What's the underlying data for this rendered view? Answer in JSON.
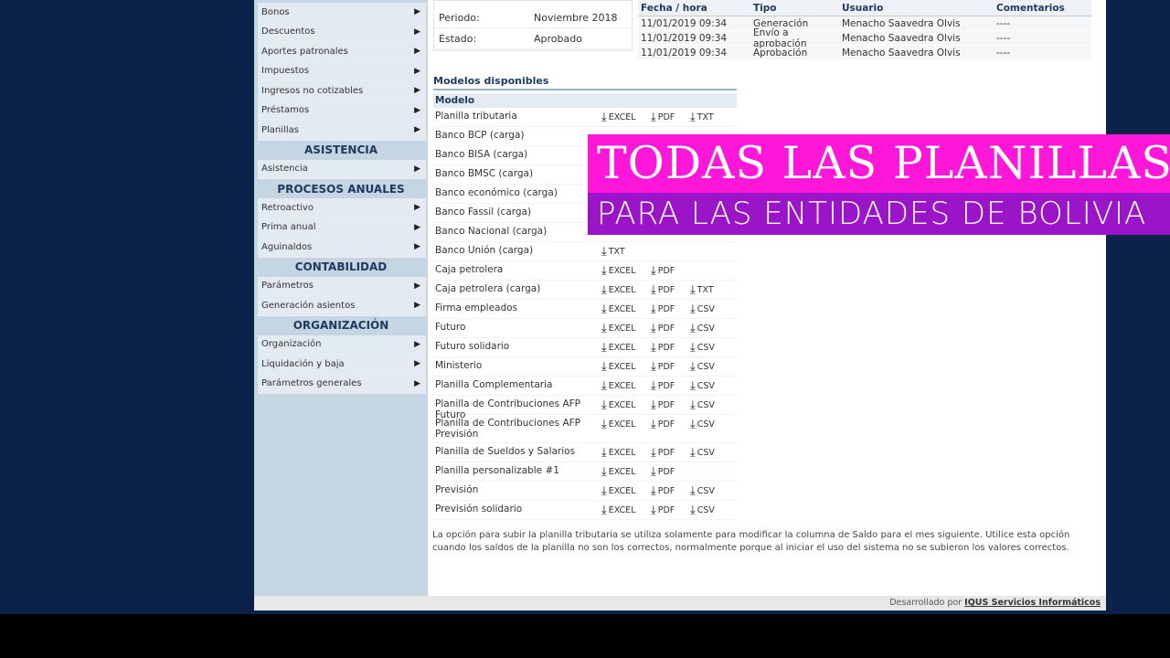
{
  "sidebar": {
    "groups": [
      {
        "heading": "",
        "items": [
          "Bonos",
          "Descuentos",
          "Aportes patronales",
          "Impuestos",
          "Ingresos no cotizables",
          "Préstamos",
          "Planillas"
        ]
      },
      {
        "heading": "ASISTENCIA",
        "items": [
          "Asistencia"
        ]
      },
      {
        "heading": "PROCESOS ANUALES",
        "items": [
          "Retroactivo",
          "Prima anual",
          "Aguinaldos"
        ]
      },
      {
        "heading": "CONTABILIDAD",
        "items": [
          "Parámetros",
          "Generación asientos"
        ]
      },
      {
        "heading": "ORGANIZACIÓN",
        "items": [
          "Organización",
          "Liquidación y baja",
          "Parámetros generales"
        ]
      }
    ]
  },
  "info": {
    "period_label": "Periodo:",
    "period_value": "Noviembre 2018",
    "state_label": "Estado:",
    "state_value": "Aprobado"
  },
  "history": {
    "headers": [
      "Fecha / hora",
      "Tipo",
      "Usuario",
      "Comentarios"
    ],
    "rows": [
      [
        "11/01/2019 09:34",
        "Generación",
        "Menacho Saavedra Olvis",
        "----"
      ],
      [
        "11/01/2019 09:34",
        "Envío a aprobación",
        "Menacho Saavedra Olvis",
        "----"
      ],
      [
        "11/01/2019 09:34",
        "Aprobación",
        "Menacho Saavedra Olvis",
        "----"
      ]
    ]
  },
  "models": {
    "title": "Modelos disponibles",
    "column_header": "Modelo",
    "rows": [
      {
        "name": "Planilla tributaria",
        "dl": [
          "EXCEL",
          "PDF",
          "TXT"
        ]
      },
      {
        "name": "Banco BCP (carga)",
        "dl": [
          "",
          "",
          ""
        ]
      },
      {
        "name": "Banco BISA (carga)",
        "dl": [
          "",
          "",
          ""
        ]
      },
      {
        "name": "Banco BMSC (carga)",
        "dl": [
          "",
          "",
          ""
        ]
      },
      {
        "name": "Banco económico (carga)",
        "dl": [
          "",
          "",
          ""
        ]
      },
      {
        "name": "Banco Fassil (carga)",
        "dl": [
          "",
          "",
          ""
        ]
      },
      {
        "name": "Banco Nacional (carga)",
        "dl": [
          "",
          "",
          ""
        ]
      },
      {
        "name": "Banco Unión (carga)",
        "dl": [
          "TXT",
          "",
          ""
        ]
      },
      {
        "name": "Caja petrolera",
        "dl": [
          "EXCEL",
          "PDF",
          ""
        ]
      },
      {
        "name": "Caja petrolera (carga)",
        "dl": [
          "EXCEL",
          "PDF",
          "TXT"
        ]
      },
      {
        "name": "Firma empleados",
        "dl": [
          "EXCEL",
          "PDF",
          "CSV"
        ]
      },
      {
        "name": "Futuro",
        "dl": [
          "EXCEL",
          "PDF",
          "CSV"
        ]
      },
      {
        "name": "Futuro solidario",
        "dl": [
          "EXCEL",
          "PDF",
          "CSV"
        ]
      },
      {
        "name": "Ministerio",
        "dl": [
          "EXCEL",
          "PDF",
          "CSV"
        ]
      },
      {
        "name": "Planilla Complementaria",
        "dl": [
          "EXCEL",
          "PDF",
          "CSV"
        ]
      },
      {
        "name": "Planilla de Contribuciones AFP Futuro",
        "dl": [
          "EXCEL",
          "PDF",
          "CSV"
        ]
      },
      {
        "name": "Planilla de Contribuciones AFP Previsión",
        "dl": [
          "EXCEL",
          "PDF",
          "CSV"
        ],
        "tall": true
      },
      {
        "name": "Planilla de Sueldos y Salarios",
        "dl": [
          "EXCEL",
          "PDF",
          "CSV"
        ]
      },
      {
        "name": "Planilla personalizable #1",
        "dl": [
          "EXCEL",
          "PDF",
          ""
        ]
      },
      {
        "name": "Previsión",
        "dl": [
          "EXCEL",
          "PDF",
          "CSV"
        ]
      },
      {
        "name": "Previsión solidario",
        "dl": [
          "EXCEL",
          "PDF",
          "CSV"
        ]
      }
    ]
  },
  "note": "La opción para subir la planilla tributaria se utiliza solamente para modificar la columna de Saldo para el mes siguiente. Utilice esta opción cuando los saldos de la planilla no son los correctos, normalmente porque al iniciar el uso del sistema no se subieron los valores correctos.",
  "footer": {
    "prefix": "Desarrollado por",
    "company": "IQUS Servicios Informáticos"
  },
  "banner": {
    "line1": "TODAS LAS PLANILLAS",
    "line2": "PARA LAS ENTIDADES DE BOLIVIA"
  },
  "colors": {
    "banner_top": "#ff17d9",
    "banner_bottom": "#9b15c8",
    "background": "#0b2348"
  }
}
